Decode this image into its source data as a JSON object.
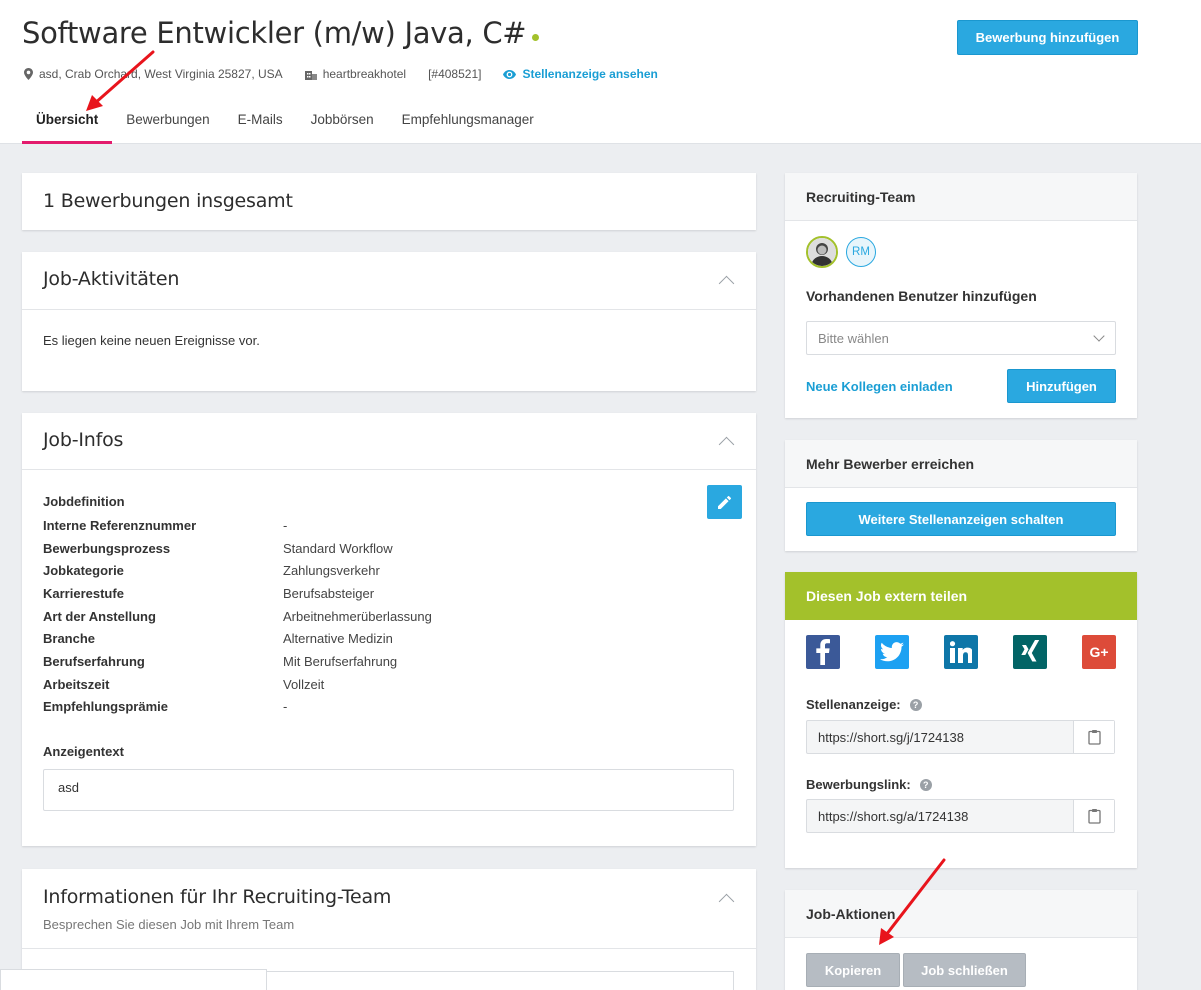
{
  "header": {
    "job_title": "Software Entwickler (m/w) Java, C#",
    "location": "asd, Crab Orchard, West Virginia 25827, USA",
    "company": "heartbreakhotel",
    "job_id": "[#408521]",
    "view_ad_link": "Stellenanzeige ansehen",
    "add_application_button": "Bewerbung hinzufügen",
    "status_color": "#a3c12b"
  },
  "tabs": [
    {
      "label": "Übersicht",
      "active": true
    },
    {
      "label": "Bewerbungen",
      "active": false
    },
    {
      "label": "E-Mails",
      "active": false
    },
    {
      "label": "Jobbörsen",
      "active": false
    },
    {
      "label": "Empfehlungsmanager",
      "active": false
    }
  ],
  "main": {
    "total_applications": "1 Bewerbungen insgesamt",
    "activities": {
      "title": "Job-Aktivitäten",
      "empty_text": "Es liegen keine neuen Ereignisse vor."
    },
    "infos": {
      "title": "Job-Infos",
      "definition_title": "Jobdefinition",
      "rows": [
        {
          "label": "Interne Referenznummer",
          "value": "-"
        },
        {
          "label": "Bewerbungsprozess",
          "value": "Standard Workflow"
        },
        {
          "label": "Jobkategorie",
          "value": "Zahlungsverkehr"
        },
        {
          "label": "Karrierestufe",
          "value": "Berufsabsteiger"
        },
        {
          "label": "Art der Anstellung",
          "value": "Arbeitnehmerüberlassung"
        },
        {
          "label": "Branche",
          "value": "Alternative Medizin"
        },
        {
          "label": "Berufserfahrung",
          "value": "Mit Berufserfahrung"
        },
        {
          "label": "Arbeitszeit",
          "value": "Vollzeit"
        },
        {
          "label": "Empfehlungsprämie",
          "value": "-"
        }
      ],
      "ad_text_label": "Anzeigentext",
      "ad_text_value": "asd"
    },
    "team_info": {
      "title": "Informationen für Ihr Recruiting-Team",
      "subtitle": "Besprechen Sie diesen Job mit Ihrem Team"
    }
  },
  "sidebar": {
    "recruiting_team": {
      "title": "Recruiting-Team",
      "avatar_initials": "RM",
      "add_user_title": "Vorhandenen Benutzer hinzufügen",
      "select_placeholder": "Bitte wählen",
      "invite_link": "Neue Kollegen einladen",
      "add_button": "Hinzufügen"
    },
    "more_applicants": {
      "title": "Mehr Bewerber erreichen",
      "button": "Weitere Stellenanzeigen schalten"
    },
    "share": {
      "title": "Diesen Job extern teilen",
      "header_color": "#a3c12b",
      "job_ad_label": "Stellenanzeige:",
      "job_ad_url": "https://short.sg/j/1724138",
      "apply_link_label": "Bewerbungslink:",
      "apply_link_url": "https://short.sg/a/1724138",
      "socials": [
        "facebook-icon",
        "twitter-icon",
        "linkedin-icon",
        "xing-icon",
        "google-plus-icon"
      ]
    },
    "actions": {
      "title": "Job-Aktionen",
      "copy_button": "Kopieren",
      "close_button": "Job schließen"
    }
  },
  "colors": {
    "accent_blue": "#2aa8e0",
    "tab_active": "#e31b6d",
    "annotation_red": "#e8141c"
  }
}
